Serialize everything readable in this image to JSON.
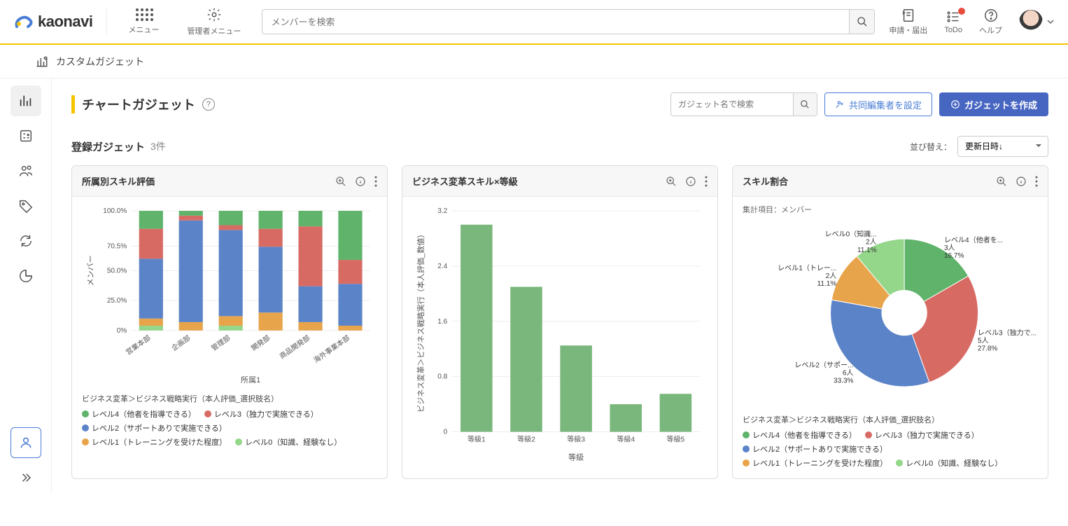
{
  "header": {
    "brand": "kaonavi",
    "menu_label": "メニュー",
    "admin_menu_label": "管理者メニュー",
    "search_placeholder": "メンバーを検索",
    "actions": {
      "apply": "申請・届出",
      "todo": "ToDo",
      "help": "ヘルプ"
    }
  },
  "sub": {
    "title": "カスタムガジェット"
  },
  "page": {
    "title": "チャートガジェット",
    "gadget_search_placeholder": "ガジェット名で検索",
    "coeditor_btn": "共同編集者を設定",
    "create_btn": "ガジェットを作成"
  },
  "list": {
    "title": "登録ガジェット",
    "count": "3件",
    "sort_label": "並び替え：",
    "sort_value": "更新日時↓"
  },
  "legend_shared": {
    "title": "ビジネス変革＞ビジネス戦略実行（本人評価_選択肢名）",
    "items": [
      {
        "label": "レベル4（他者を指導できる）",
        "color": "#5fb36a"
      },
      {
        "label": "レベル3（独力で実施できる）",
        "color": "#d86a64"
      },
      {
        "label": "レベル2（サポートありで実施できる）",
        "color": "#5b83c7"
      },
      {
        "label": "レベル1（トレーニングを受けた程度）",
        "color": "#e8a44a"
      },
      {
        "label": "レベル0（知識、経験なし）",
        "color": "#94d68a"
      }
    ]
  },
  "cards": [
    {
      "title": "所属別スキル評価",
      "xlabel": "所属1",
      "ylabel": "メンバー"
    },
    {
      "title": "ビジネス変革スキル×等級",
      "xlabel": "等級",
      "ylabel": "ビジネス変革＞ビジネス戦略実行（本人評価_数値）"
    },
    {
      "title": "スキル割合",
      "subtitle": "集計項目：メンバー"
    }
  ],
  "chart_data": [
    {
      "type": "bar",
      "stacked": true,
      "title": "所属別スキル評価",
      "xlabel": "所属1",
      "ylabel": "メンバー",
      "categories": [
        "営業本部",
        "企画部",
        "管理部",
        "開発部",
        "商品開発部",
        "海外事業本部"
      ],
      "ylim": [
        0,
        100
      ],
      "yticks": [
        "0%",
        "25.0%",
        "50.0%",
        "70.5%",
        "100.0%"
      ],
      "series": [
        {
          "name": "レベル0（知識、経験なし）",
          "color": "#94d68a",
          "values": [
            4,
            0,
            4,
            0,
            0,
            0
          ]
        },
        {
          "name": "レベル1（トレーニングを受けた程度）",
          "color": "#e8a44a",
          "values": [
            6,
            7,
            8,
            15,
            7,
            4
          ]
        },
        {
          "name": "レベル2（サポートありで実施できる）",
          "color": "#5b83c7",
          "values": [
            50,
            85,
            72,
            55,
            30,
            35
          ]
        },
        {
          "name": "レベル3（独力で実施できる）",
          "color": "#d86a64",
          "values": [
            25,
            4,
            4,
            15,
            50,
            20
          ]
        },
        {
          "name": "レベル4（他者を指導できる）",
          "color": "#5fb36a",
          "values": [
            15,
            4,
            12,
            15,
            13,
            41
          ]
        }
      ]
    },
    {
      "type": "bar",
      "title": "ビジネス変革スキル×等級",
      "xlabel": "等級",
      "ylabel": "ビジネス変革＞ビジネス戦略実行（本人評価_数値）",
      "categories": [
        "等級1",
        "等級2",
        "等級3",
        "等級4",
        "等級5"
      ],
      "ylim": [
        0,
        3.2
      ],
      "yticks": [
        "0",
        "0.8",
        "1.6",
        "2.4",
        "3.2"
      ],
      "values": [
        3.0,
        2.1,
        1.25,
        0.4,
        0.55
      ],
      "color": "#79b77c"
    },
    {
      "type": "pie",
      "title": "スキル割合",
      "subtitle": "集計項目：メンバー",
      "slices": [
        {
          "label": "レベル4（他者を...",
          "count": "3人",
          "pct": "16.7%",
          "value": 16.7,
          "color": "#5fb36a"
        },
        {
          "label": "レベル3（独力で...",
          "count": "5人",
          "pct": "27.8%",
          "value": 27.8,
          "color": "#d86a64"
        },
        {
          "label": "レベル2（サポー...",
          "count": "6人",
          "pct": "33.3%",
          "value": 33.3,
          "color": "#5b83c7"
        },
        {
          "label": "レベル1（トレー...",
          "count": "2人",
          "pct": "11.1%",
          "value": 11.1,
          "color": "#e8a44a"
        },
        {
          "label": "レベル0（知識...",
          "count": "2人",
          "pct": "11.1%",
          "value": 11.1,
          "color": "#94d68a"
        }
      ]
    }
  ]
}
